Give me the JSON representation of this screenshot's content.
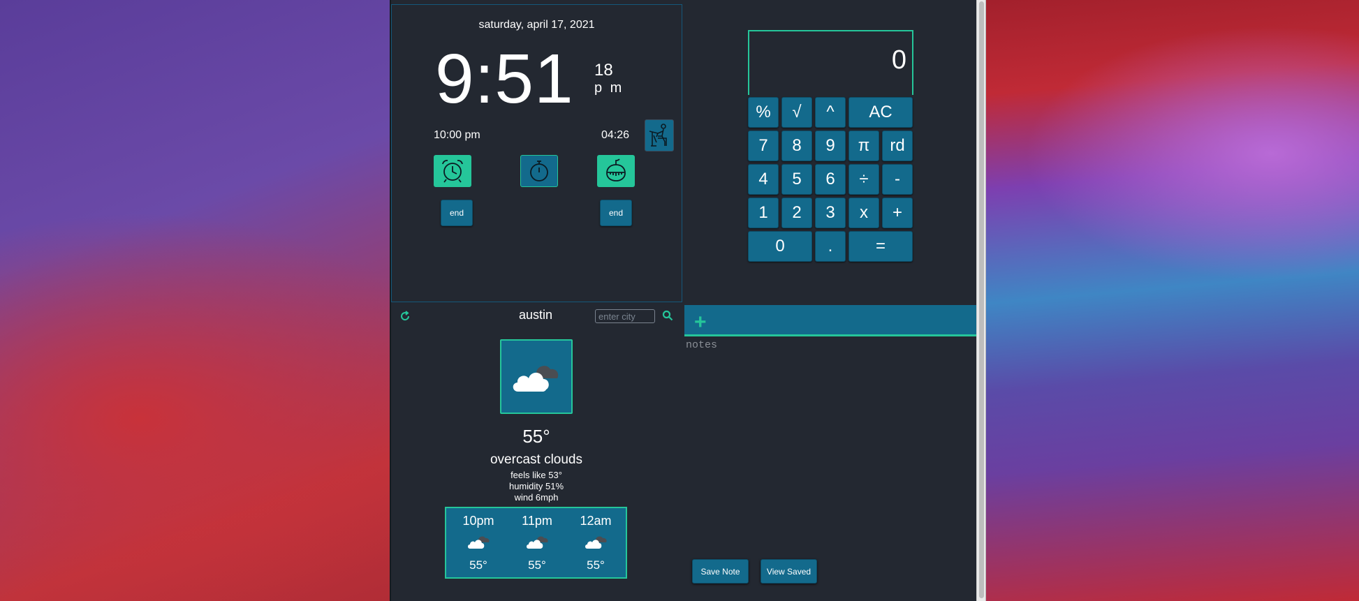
{
  "clock": {
    "date": "saturday, april 17, 2021",
    "time": "9:51",
    "seconds": "18",
    "ampm": "p m",
    "alarm_time": "10:00 pm",
    "timer_time": "04:26",
    "end_label": "end",
    "icons": [
      "alarm-clock-icon",
      "stopwatch-icon",
      "pomodoro-timer-icon",
      "desk-worker-icon"
    ]
  },
  "calculator": {
    "display": "0",
    "keys": {
      "percent": "%",
      "sqrt": "√",
      "power": "^",
      "clear": "AC",
      "seven": "7",
      "eight": "8",
      "nine": "9",
      "pi": "π",
      "random": "rd",
      "four": "4",
      "five": "5",
      "six": "6",
      "divide": "÷",
      "minus": "-",
      "one": "1",
      "two": "2",
      "three": "3",
      "multiply": "x",
      "plus": "+",
      "zero": "0",
      "decimal": ".",
      "equals": "="
    }
  },
  "weather": {
    "city": "austin",
    "city_placeholder": "enter city",
    "temperature": "55°",
    "description": "overcast clouds",
    "feels_like": "feels like 53°",
    "humidity": "humidity 51%",
    "wind": "wind 6mph",
    "icon": "overcast-clouds-icon",
    "forecast": [
      {
        "time": "10pm",
        "temp": "55°"
      },
      {
        "time": "11pm",
        "temp": "55°"
      },
      {
        "time": "12am",
        "temp": "55°"
      }
    ]
  },
  "notes": {
    "add_label": "+",
    "placeholder": "notes",
    "save_label": "Save Note",
    "view_label": "View Saved"
  },
  "colors": {
    "background": "#232831",
    "accent": "#25c69a",
    "button": "#136a8c"
  }
}
